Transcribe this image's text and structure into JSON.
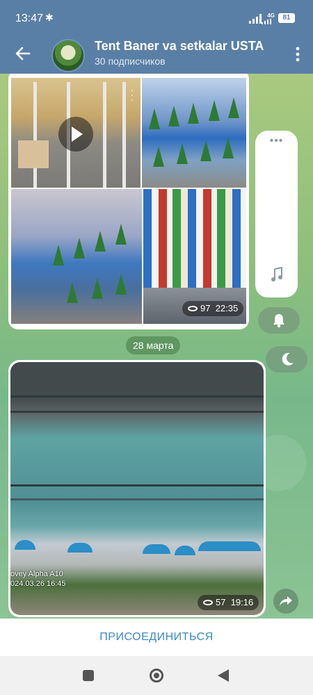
{
  "status_bar": {
    "time": "13:47",
    "network": "4G",
    "battery": "81",
    "icons": [
      "gear-icon",
      "signal-icon",
      "battery-icon"
    ]
  },
  "header": {
    "title": "Tent Baner va setkalar USTA",
    "subscribers": "30 подписчиков",
    "icons": [
      "back-arrow-icon",
      "more-vertical-icon"
    ]
  },
  "messages": [
    {
      "type": "album",
      "views": "97",
      "time": "22:35",
      "photos": [
        "video-thumbnail-canopy",
        "banner-fence-trees",
        "banner-fence-perspective",
        "striped-tarp-rolls"
      ]
    },
    {
      "type": "photo",
      "views": "57",
      "time": "19:16",
      "watermark_line1": "ovey Alpha A10",
      "watermark_line2": "024.03.26 16:45"
    }
  ],
  "date_chip": "28 марта",
  "side_controls": {
    "icons": [
      "more-dots-icon",
      "music-note-icon",
      "bell-icon",
      "moon-icon",
      "share-icon"
    ]
  },
  "join_button": "ПРИСОЕДИНИТЬСЯ",
  "colors": {
    "header_bg": "#5a7fa6",
    "accent": "#3c88c9",
    "chat_bg": "#8ebf7c"
  },
  "nav_icons": [
    "recent-apps-icon",
    "home-icon",
    "back-triangle-icon"
  ]
}
